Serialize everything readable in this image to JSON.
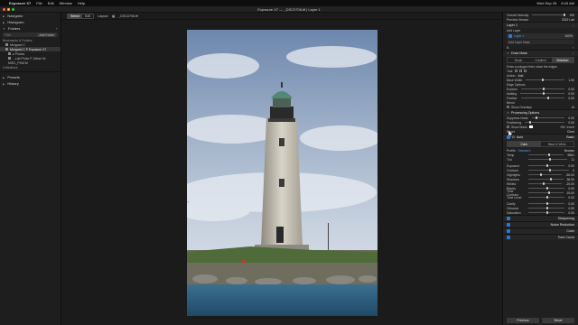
{
  "menubar": {
    "app": "Exposure X7",
    "items": [
      "File",
      "Edit",
      "Window",
      "Help"
    ],
    "right": [
      "Wed Sep 28",
      "8:43 AM"
    ]
  },
  "window": {
    "title": "Exposure X7 — _DSC0706.tif | Layer 1"
  },
  "left": {
    "navigator": "Navigator",
    "histogram": "Histogram",
    "folders": "Folders",
    "filter_placeholder": "Filter",
    "add_btn": "Add Folder",
    "bookmarks": "Bookmarks & Folders",
    "tree": [
      {
        "label": "Mergoed C",
        "selected": false
      },
      {
        "label": "Mergoed C P Exposure X7",
        "selected": true
      },
      {
        "label": "▸ Photos",
        "selected": false
      },
      {
        "label": "...Lab Photo P. Album W.",
        "selected": false
      },
      {
        "label": "MISC_PHM.M",
        "selected": false
      }
    ],
    "collections": "Collections",
    "presets": "Presets",
    "history": "History"
  },
  "toolbar": {
    "mode_left": "Select",
    "mode_right": "Edit",
    "layout_label": "Layout:",
    "filename": "_DSC0706.tif"
  },
  "right": {
    "overall_intensity": "Overall Intensity",
    "overall_intensity_val": "100",
    "preview_version": "Preview Version",
    "preview_version_val": "2022 Lab",
    "layer_title": "Layer 1",
    "add_layer": "Add Layer",
    "layer_name": "Layer 1",
    "layer_pct": "100%",
    "add_layer_mask": "Add Layer Mask",
    "draw_mask": "Draw Mask",
    "mask_tabs": [
      "Brush",
      "Gradient",
      "Selection"
    ],
    "mask_hint": "Draw a polygon then close the edges",
    "tool_label": "Tool:",
    "action_label": "Action:",
    "action_val": "Add",
    "base_width": "Base Width",
    "base_width_val": "1.00",
    "edge_options": "Edge Options",
    "expand": "Expand",
    "expand_val": "0.00",
    "matting": "Matting",
    "matting_val": "0.00",
    "feather": "Feather",
    "feather_val": "0.00",
    "blend": "Blend",
    "show_overlays": "Show Overlays",
    "processing_options": "Processing Options",
    "suppress_noise": "Suppress Noise",
    "suppress_noise_val": "0.00",
    "feathering": "Feathering",
    "feathering_val": "0.00",
    "show_mask": "Show Mask",
    "show_mask_val": "0%",
    "invert": "Invert",
    "reset": "Reset",
    "clear": "Clear",
    "basic": "Basic",
    "auto": "Auto",
    "color": "Color",
    "bw": "Black & White",
    "profile": "Profile:",
    "profile_val": "Standard",
    "browse": "Browse",
    "sliders": [
      {
        "label": "Temp",
        "val": "5561",
        "pos": 0.55
      },
      {
        "label": "Tint",
        "val": "11",
        "pos": 0.52
      },
      {
        "label": "Exposure",
        "val": "0.00",
        "pos": 0.5
      },
      {
        "label": "Contrast",
        "val": "0",
        "pos": 0.5
      },
      {
        "label": "Highlights",
        "val": "-50.00",
        "pos": 0.35
      },
      {
        "label": "Shadows",
        "val": "36.00",
        "pos": 0.62
      },
      {
        "label": "Whites",
        "val": "-20.00",
        "pos": 0.42
      },
      {
        "label": "Blacks",
        "val": "0.00",
        "pos": 0.5
      },
      {
        "label": "Tone Contrast",
        "val": "15.00",
        "pos": 0.58
      },
      {
        "label": "Tone Level",
        "val": "0.00",
        "pos": 0.5
      },
      {
        "label": "Clarity",
        "val": "0.00",
        "pos": 0.5
      },
      {
        "label": "Vibrance",
        "val": "0.00",
        "pos": 0.5
      },
      {
        "label": "Saturation",
        "val": "0.00",
        "pos": 0.5
      }
    ],
    "sections": [
      "Sharpening",
      "Noise Reduction",
      "Color",
      "Tone Curve"
    ],
    "previous": "Previous",
    "reset_btn": "Reset"
  }
}
